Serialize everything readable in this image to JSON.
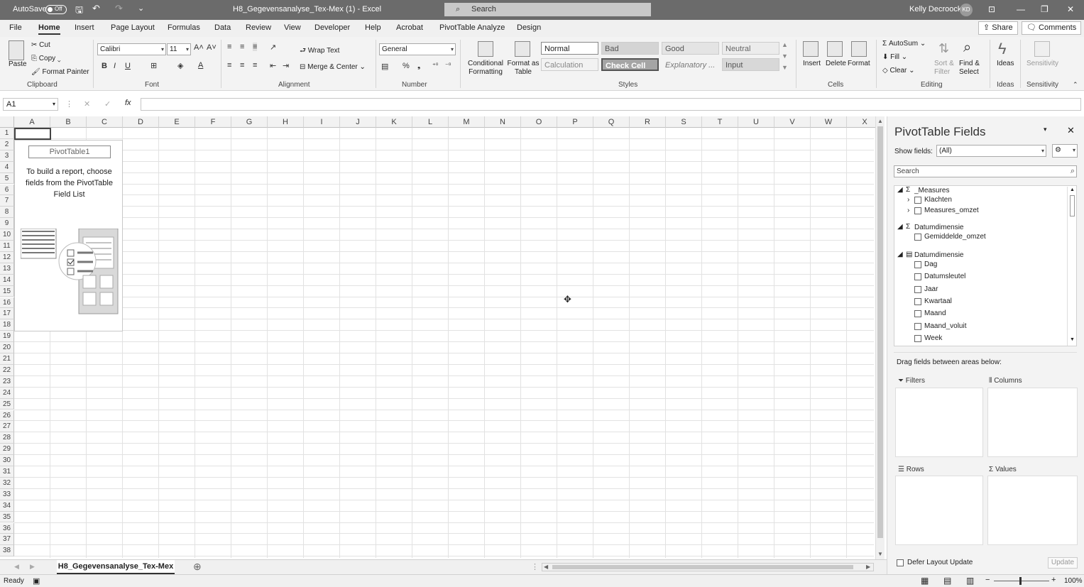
{
  "titlebar": {
    "autosave_label": "AutoSave",
    "autosave_state": "Off",
    "file_title": "H8_Gegevensanalyse_Tex-Mex (1)  -  Excel",
    "search_placeholder": "Search",
    "user_name": "Kelly Decroock",
    "user_initials": "KD"
  },
  "menu": {
    "items": [
      "File",
      "Home",
      "Insert",
      "Page Layout",
      "Formulas",
      "Data",
      "Review",
      "View",
      "Developer",
      "Help",
      "Acrobat",
      "PivotTable Analyze",
      "Design"
    ],
    "share": "Share",
    "comments": "Comments"
  },
  "ribbon": {
    "clipboard": {
      "paste": "Paste",
      "cut": "Cut",
      "copy": "Copy",
      "format_painter": "Format Painter",
      "label": "Clipboard"
    },
    "font": {
      "name": "Calibri",
      "size": "11",
      "label": "Font"
    },
    "alignment": {
      "wrap": "Wrap Text",
      "merge": "Merge & Center",
      "label": "Alignment"
    },
    "number": {
      "format": "General",
      "label": "Number"
    },
    "styles": {
      "cond_format": "Conditional Formatting",
      "format_table": "Format as Table",
      "normal": "Normal",
      "bad": "Bad",
      "good": "Good",
      "neutral": "Neutral",
      "calculation": "Calculation",
      "check_cell": "Check Cell",
      "explanatory": "Explanatory ...",
      "input": "Input",
      "label": "Styles"
    },
    "cells": {
      "insert": "Insert",
      "delete": "Delete",
      "format": "Format",
      "label": "Cells"
    },
    "editing": {
      "autosum": "AutoSum",
      "fill": "Fill",
      "clear": "Clear",
      "sort": "Sort & Filter",
      "find": "Find & Select",
      "label": "Editing"
    },
    "ideas": {
      "ideas": "Ideas",
      "label": "Ideas"
    },
    "sensitivity": {
      "sensitivity": "Sensitivity",
      "label": "Sensitivity"
    }
  },
  "formulabar": {
    "namebox": "A1",
    "fx": "fx"
  },
  "grid": {
    "columns": [
      "A",
      "B",
      "C",
      "D",
      "E",
      "F",
      "G",
      "H",
      "I",
      "J",
      "K",
      "L",
      "M",
      "N",
      "O",
      "P",
      "Q",
      "R",
      "S",
      "T",
      "U",
      "V",
      "W",
      "X"
    ],
    "rows": [
      "1",
      "2",
      "3",
      "4",
      "5",
      "6",
      "7",
      "8",
      "9",
      "10",
      "11",
      "12",
      "13",
      "14",
      "15",
      "16",
      "17",
      "18",
      "19",
      "20",
      "21",
      "22",
      "23",
      "24",
      "25",
      "26",
      "27",
      "28",
      "29",
      "30",
      "31",
      "32",
      "33",
      "34",
      "35",
      "36",
      "37",
      "38"
    ],
    "pivot_name": "PivotTable1",
    "pivot_instructions": "To build a report, choose fields from the PivotTable Field List"
  },
  "pivot_pane": {
    "title": "PivotTable Fields",
    "show_fields_label": "Show fields:",
    "show_fields_value": "(All)",
    "search_placeholder": "Search",
    "groups": [
      {
        "name": "_Measures",
        "items": [
          "Klachten",
          "Measures_omzet"
        ]
      },
      {
        "name": "Datumdimensie",
        "items": [
          "Gemiddelde_omzet"
        ]
      },
      {
        "name": "Datumdimensie",
        "items": [
          "Dag",
          "Datumsleutel",
          "Jaar",
          "Kwartaal",
          "Maand",
          "Maand_voluit",
          "Week"
        ]
      }
    ],
    "drag_hint": "Drag fields between areas below:",
    "areas": {
      "filters": "Filters",
      "columns": "Columns",
      "rows": "Rows",
      "values": "Values"
    },
    "defer": "Defer Layout Update",
    "update": "Update"
  },
  "sheet_tab": "H8_Gegevensanalyse_Tex-Mex",
  "status": {
    "ready": "Ready",
    "zoom": "100%"
  }
}
